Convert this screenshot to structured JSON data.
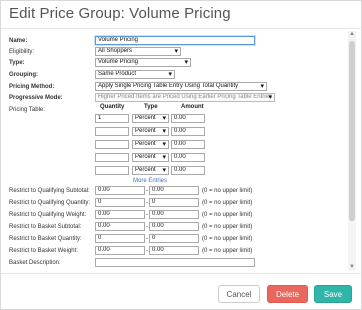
{
  "dialog": {
    "title": "Edit Price Group: Volume Pricing"
  },
  "form": {
    "name_label": "Name:",
    "name_value": "Volume Pricing",
    "eligibility_label": "Eligibility:",
    "eligibility_value": "All Shoppers",
    "type_label": "Type:",
    "type_value": "Volume Pricing",
    "grouping_label": "Grouping:",
    "grouping_value": "Same Product",
    "pricing_method_label": "Pricing Method:",
    "pricing_method_value": "Apply Single Pricing Table Entry Using Total Quantity",
    "progressive_mode_label": "Progressive Mode:",
    "progressive_mode_value": "Higher Priced Items are Priced Using Earlier Pricing Table Entries",
    "pricing_table_label": "Pricing Table:",
    "pricing_table": {
      "headers": [
        "Quantity",
        "Type",
        "Amount"
      ],
      "rows": [
        {
          "quantity": "1",
          "type": "Percent",
          "amount": "0.00"
        },
        {
          "quantity": "",
          "type": "Percent",
          "amount": "0.00"
        },
        {
          "quantity": "",
          "type": "Percent",
          "amount": "0.00"
        },
        {
          "quantity": "",
          "type": "Percent",
          "amount": "0.00"
        },
        {
          "quantity": "",
          "type": "Percent",
          "amount": "0.00"
        }
      ],
      "more_entries": "More Entries"
    },
    "restrictions": [
      {
        "label": "Restrict to Qualifying Subtotal:",
        "from": "0.00",
        "to": "0.00",
        "hint": "(0 = no upper limit)"
      },
      {
        "label": "Restrict to Qualifying Quantity:",
        "from": "0",
        "to": "0",
        "hint": "(0 = no upper limit)"
      },
      {
        "label": "Restrict to Qualifying Weight:",
        "from": "0.00",
        "to": "0.00",
        "hint": "(0 = no upper limit)"
      },
      {
        "label": "Restrict to Basket Subtotal:",
        "from": "0.00",
        "to": "0.00",
        "hint": "(0 = no upper limit)"
      },
      {
        "label": "Restrict to Basket Quantity:",
        "from": "0",
        "to": "0",
        "hint": "(0 = no upper limit)"
      },
      {
        "label": "Restrict to Basket Weight:",
        "from": "0.00",
        "to": "0.00",
        "hint": "(0 = no upper limit)"
      }
    ],
    "basket_description_label": "Basket Description:",
    "basket_description_value": ""
  },
  "buttons": {
    "cancel": "Cancel",
    "delete": "Delete",
    "save": "Save"
  },
  "colors": {
    "delete": "#e9675d",
    "save": "#2fb6a8",
    "link": "#3b78c0"
  }
}
